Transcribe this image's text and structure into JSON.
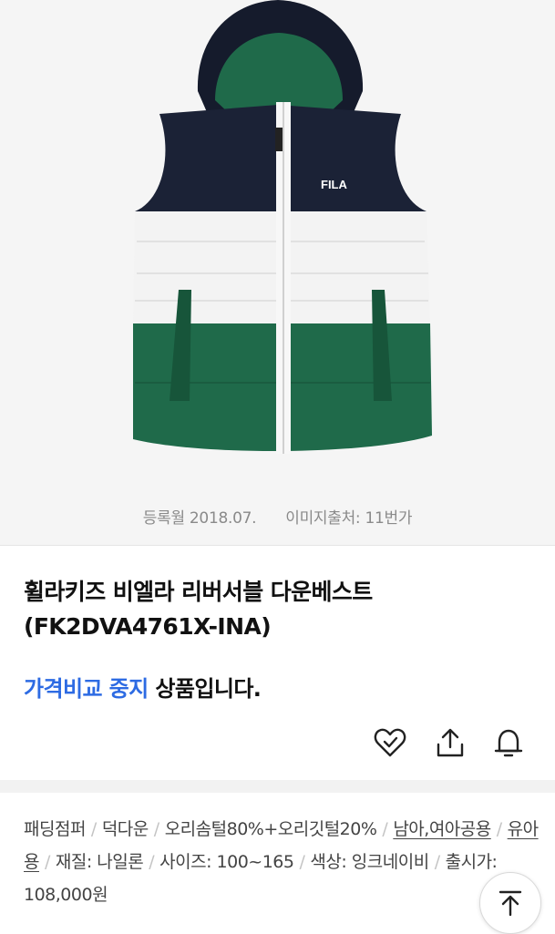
{
  "product": {
    "image_alt": "",
    "image_brand_text": "FILA",
    "registered": "등록월 2018.07.",
    "image_source": "이미지출처: 11번가",
    "title": "휠라키즈 비엘라 리버서블 다운베스트 (FK2DVA4761X-INA)",
    "status_link": "가격비교 중지",
    "status_suffix": " 상품입니다."
  },
  "actions": {
    "like_icon": "heart-check-icon",
    "share_icon": "share-icon",
    "alert_icon": "bell-icon"
  },
  "specs": {
    "items": [
      "패딩점퍼",
      "덕다운",
      "오리솜털80%+오리깃털20%",
      "남아,여아공용",
      "유아용",
      "재질: 나일론",
      "사이즈: 100~165",
      "색상: 잉크네이비",
      "출시가: 108,000원"
    ]
  },
  "scroll_top": {
    "icon": "arrow-up-to-top-icon"
  },
  "colors": {
    "accent": "#2d6be3",
    "vest_navy": "#1b2236",
    "vest_white": "#f3f3f3",
    "vest_green": "#1f6a4a"
  }
}
